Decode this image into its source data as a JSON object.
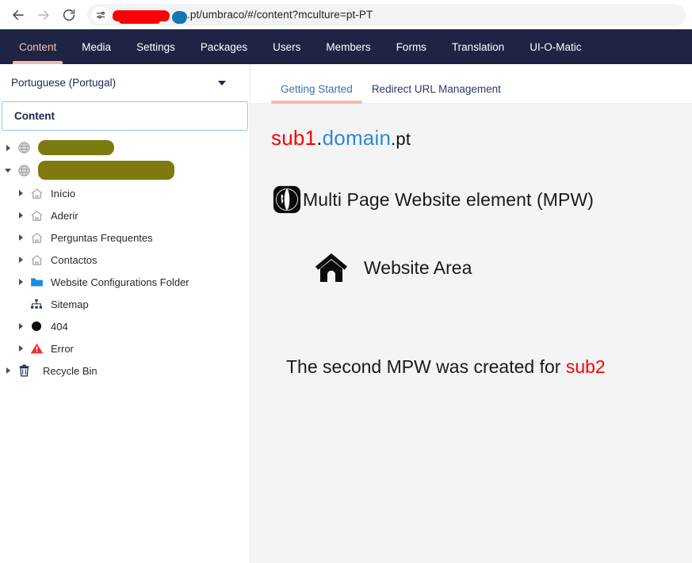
{
  "browser": {
    "back_icon": "back-arrow-icon",
    "forward_icon": "forward-arrow-icon",
    "reload_icon": "reload-icon",
    "site_settings_icon": "page-settings-sliders-icon",
    "url_visible_text": ".pt/umbraco/#/content?mculture=pt-PT",
    "url_redacted_primary_color": "#fb0007",
    "url_redacted_secondary_color": "#1578b4"
  },
  "umbraco_nav": {
    "items": [
      {
        "label": "Content",
        "active": true
      },
      {
        "label": "Media",
        "active": false
      },
      {
        "label": "Settings",
        "active": false
      },
      {
        "label": "Packages",
        "active": false
      },
      {
        "label": "Users",
        "active": false
      },
      {
        "label": "Members",
        "active": false
      },
      {
        "label": "Forms",
        "active": false
      },
      {
        "label": "Translation",
        "active": false
      },
      {
        "label": "UI-O-Matic",
        "active": false
      }
    ],
    "background_color": "#1f2445",
    "active_color": "#f5c1b4"
  },
  "sidebar": {
    "language_selector": {
      "value": "Portuguese (Portugal)",
      "chevron_icon": "chevron-down-icon"
    },
    "section_header": "Content",
    "redaction_color": "#7c7a10",
    "tree": [
      {
        "label": "",
        "redacted": true,
        "redact_width": 96,
        "icon": "globe-icon",
        "arrow": "right",
        "level": 1
      },
      {
        "label": "",
        "redacted": true,
        "redact_width": 172,
        "icon": "globe-icon",
        "arrow": "down",
        "level": 1
      },
      {
        "label": "Início",
        "redacted": false,
        "icon": "home-icon",
        "arrow": "right",
        "level": 2
      },
      {
        "label": "Aderir",
        "redacted": false,
        "icon": "home-icon",
        "arrow": "right",
        "level": 2
      },
      {
        "label": "Perguntas Frequentes",
        "redacted": false,
        "icon": "home-icon",
        "arrow": "right",
        "level": 2
      },
      {
        "label": "Contactos",
        "redacted": false,
        "icon": "home-icon",
        "arrow": "right",
        "level": 2
      },
      {
        "label": "Website Configurations Folder",
        "redacted": false,
        "icon": "folder-icon",
        "arrow": "right",
        "level": 2
      },
      {
        "label": "Sitemap",
        "redacted": false,
        "icon": "sitemap-icon",
        "arrow": "none",
        "level": 2
      },
      {
        "label": "404",
        "redacted": false,
        "icon": "circle-icon",
        "arrow": "right",
        "level": 2
      },
      {
        "label": "Error",
        "redacted": false,
        "icon": "warning-triangle-icon",
        "arrow": "right",
        "level": 2
      },
      {
        "label": "Recycle Bin",
        "redacted": false,
        "icon": "trash-icon",
        "arrow": "right",
        "level": 1
      }
    ]
  },
  "main": {
    "tabs": [
      {
        "label": "Getting Started",
        "active": true
      },
      {
        "label": "Redirect URL Management",
        "active": false
      }
    ],
    "domain_title": {
      "sub": "sub1",
      "dot1": ".",
      "mid": "domain",
      "tld": ".pt",
      "sub_color": "#f80207",
      "mid_color": "#2b8ad6",
      "tld_color": "#101010"
    },
    "mpw": {
      "icon": "globe-black-icon",
      "label": "Multi Page Website element (MPW)"
    },
    "website_area": {
      "icon": "home-black-icon",
      "label": "Website Area"
    },
    "note": {
      "text": "The second MPW was created for ",
      "highlight": "sub2",
      "highlight_color": "#f70106"
    }
  }
}
